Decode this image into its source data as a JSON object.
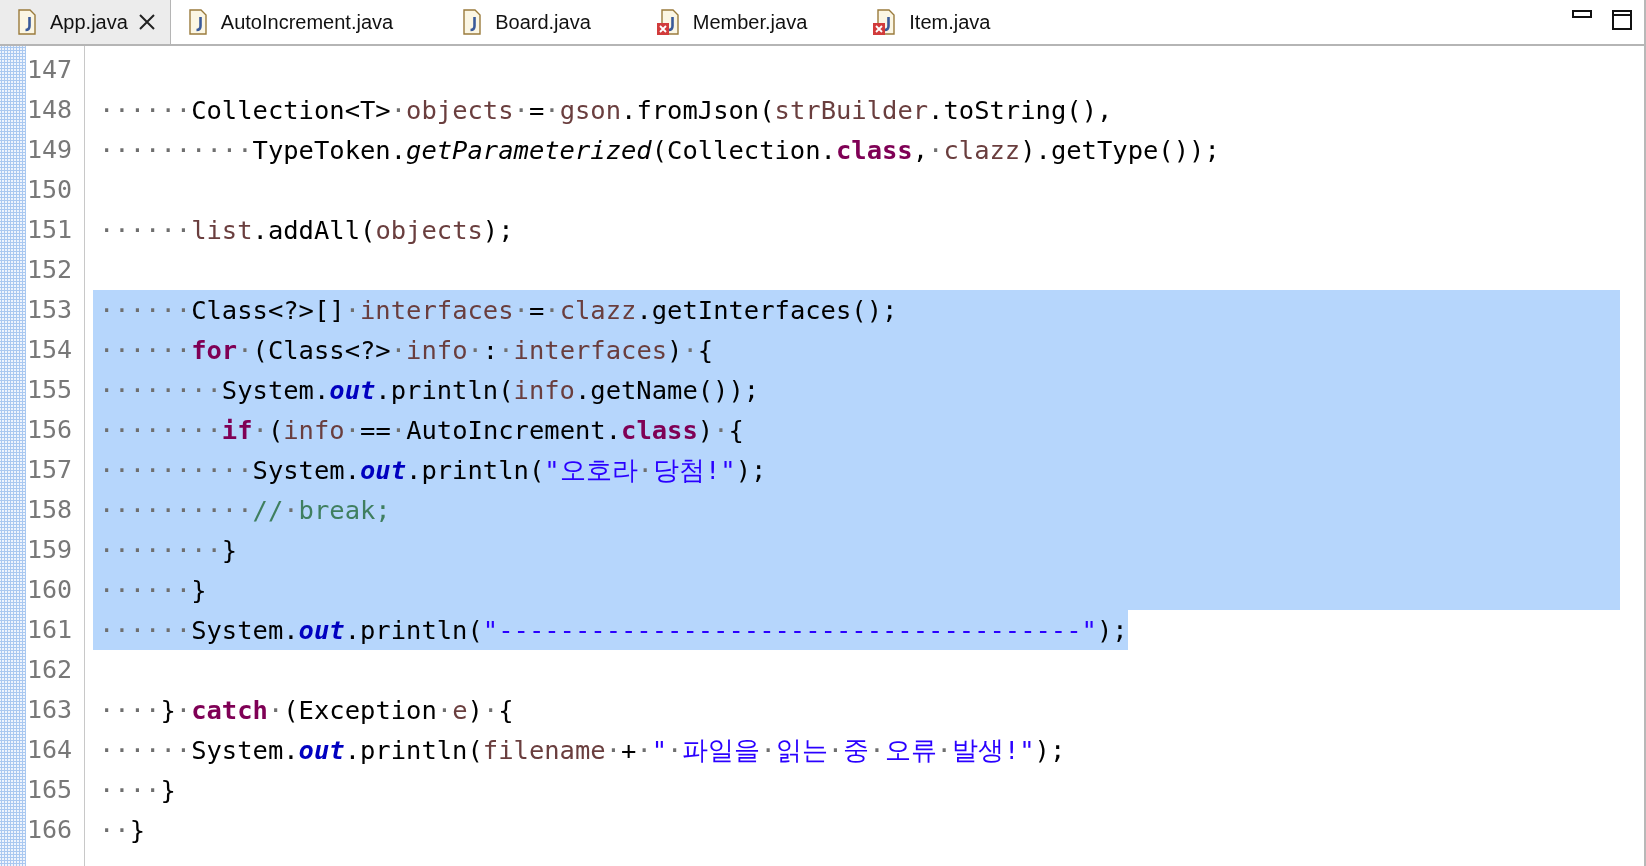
{
  "tabs": [
    {
      "label": "App.java",
      "selected": true,
      "error": false
    },
    {
      "label": "AutoIncrement.java",
      "selected": false,
      "error": false
    },
    {
      "label": "Board.java",
      "selected": false,
      "error": false
    },
    {
      "label": "Member.java",
      "selected": false,
      "error": true
    },
    {
      "label": "Item.java",
      "selected": false,
      "error": true
    }
  ],
  "lines": [
    {
      "number": "147",
      "selected": false
    },
    {
      "number": "148",
      "selected": false,
      "tokens": [
        {
          "kind": "ws",
          "t": "······"
        },
        {
          "kind": "plain",
          "t": "Collection<T>"
        },
        {
          "kind": "ws",
          "t": "·"
        },
        {
          "kind": "var",
          "t": "objects"
        },
        {
          "kind": "ws",
          "t": "·"
        },
        {
          "kind": "plain",
          "t": "="
        },
        {
          "kind": "ws",
          "t": "·"
        },
        {
          "kind": "var",
          "t": "gson"
        },
        {
          "kind": "plain",
          "t": ".fromJson("
        },
        {
          "kind": "var",
          "t": "strBuilder"
        },
        {
          "kind": "plain",
          "t": ".toString(),"
        }
      ]
    },
    {
      "number": "149",
      "selected": false,
      "tokens": [
        {
          "kind": "ws",
          "t": "··········"
        },
        {
          "kind": "plain",
          "t": "TypeToken."
        },
        {
          "kind": "italic",
          "t": "getParameterized"
        },
        {
          "kind": "plain",
          "t": "(Collection."
        },
        {
          "kind": "kw",
          "t": "class"
        },
        {
          "kind": "plain",
          "t": ","
        },
        {
          "kind": "ws",
          "t": "·"
        },
        {
          "kind": "var",
          "t": "clazz"
        },
        {
          "kind": "plain",
          "t": ").getType());"
        }
      ]
    },
    {
      "number": "150",
      "selected": false
    },
    {
      "number": "151",
      "selected": false,
      "tokens": [
        {
          "kind": "ws",
          "t": "······"
        },
        {
          "kind": "var",
          "t": "list"
        },
        {
          "kind": "plain",
          "t": ".addAll("
        },
        {
          "kind": "var",
          "t": "objects"
        },
        {
          "kind": "plain",
          "t": ");"
        }
      ]
    },
    {
      "number": "152",
      "selected": false
    },
    {
      "number": "153",
      "selected": true,
      "tokens": [
        {
          "kind": "ws",
          "t": "······"
        },
        {
          "kind": "plain",
          "t": "Class<?>[]"
        },
        {
          "kind": "ws",
          "t": "·"
        },
        {
          "kind": "var",
          "t": "interfaces"
        },
        {
          "kind": "ws",
          "t": "·"
        },
        {
          "kind": "plain",
          "t": "="
        },
        {
          "kind": "ws",
          "t": "·"
        },
        {
          "kind": "var",
          "t": "clazz"
        },
        {
          "kind": "plain",
          "t": ".getInterfaces();"
        }
      ]
    },
    {
      "number": "154",
      "selected": true,
      "tokens": [
        {
          "kind": "ws",
          "t": "······"
        },
        {
          "kind": "kw",
          "t": "for"
        },
        {
          "kind": "ws",
          "t": "·"
        },
        {
          "kind": "plain",
          "t": "(Class<?>"
        },
        {
          "kind": "ws",
          "t": "·"
        },
        {
          "kind": "var",
          "t": "info"
        },
        {
          "kind": "ws",
          "t": "·"
        },
        {
          "kind": "plain",
          "t": ":"
        },
        {
          "kind": "ws",
          "t": "·"
        },
        {
          "kind": "var",
          "t": "interfaces"
        },
        {
          "kind": "plain",
          "t": ")"
        },
        {
          "kind": "ws",
          "t": "·"
        },
        {
          "kind": "plain",
          "t": "{"
        }
      ]
    },
    {
      "number": "155",
      "selected": true,
      "tokens": [
        {
          "kind": "ws",
          "t": "········"
        },
        {
          "kind": "plain",
          "t": "System."
        },
        {
          "kind": "static",
          "t": "out"
        },
        {
          "kind": "plain",
          "t": ".println("
        },
        {
          "kind": "var",
          "t": "info"
        },
        {
          "kind": "plain",
          "t": ".getName());"
        }
      ]
    },
    {
      "number": "156",
      "selected": true,
      "tokens": [
        {
          "kind": "ws",
          "t": "········"
        },
        {
          "kind": "kw",
          "t": "if"
        },
        {
          "kind": "ws",
          "t": "·"
        },
        {
          "kind": "plain",
          "t": "("
        },
        {
          "kind": "var",
          "t": "info"
        },
        {
          "kind": "ws",
          "t": "·"
        },
        {
          "kind": "plain",
          "t": "=="
        },
        {
          "kind": "ws",
          "t": "·"
        },
        {
          "kind": "plain",
          "t": "AutoIncrement."
        },
        {
          "kind": "kw",
          "t": "class"
        },
        {
          "kind": "plain",
          "t": ")"
        },
        {
          "kind": "ws",
          "t": "·"
        },
        {
          "kind": "plain",
          "t": "{"
        }
      ]
    },
    {
      "number": "157",
      "selected": true,
      "tokens": [
        {
          "kind": "ws",
          "t": "··········"
        },
        {
          "kind": "plain",
          "t": "System."
        },
        {
          "kind": "static",
          "t": "out"
        },
        {
          "kind": "plain",
          "t": ".println("
        },
        {
          "kind": "str",
          "t": "\"오호라"
        },
        {
          "kind": "ws",
          "t": "·"
        },
        {
          "kind": "str",
          "t": "당첨!\""
        },
        {
          "kind": "plain",
          "t": ");"
        }
      ]
    },
    {
      "number": "158",
      "selected": true,
      "tokens": [
        {
          "kind": "ws",
          "t": "··········"
        },
        {
          "kind": "comment",
          "t": "//"
        },
        {
          "kind": "ws",
          "t": "·"
        },
        {
          "kind": "comment",
          "t": "break;"
        }
      ]
    },
    {
      "number": "159",
      "selected": true,
      "tokens": [
        {
          "kind": "ws",
          "t": "········"
        },
        {
          "kind": "plain",
          "t": "}"
        }
      ]
    },
    {
      "number": "160",
      "selected": true,
      "tokens": [
        {
          "kind": "ws",
          "t": "······"
        },
        {
          "kind": "plain",
          "t": "}"
        }
      ]
    },
    {
      "number": "161",
      "selected": true,
      "tokens": [
        {
          "kind": "ws",
          "t": "······"
        },
        {
          "kind": "plain",
          "t": "System."
        },
        {
          "kind": "static",
          "t": "out"
        },
        {
          "kind": "plain",
          "t": ".println("
        },
        {
          "kind": "str",
          "t": "\"--------------------------------------\""
        },
        {
          "kind": "plain",
          "t": ");"
        }
      ]
    },
    {
      "number": "162",
      "selected": false
    },
    {
      "number": "163",
      "selected": false,
      "tokens": [
        {
          "kind": "ws",
          "t": "····"
        },
        {
          "kind": "plain",
          "t": "}"
        },
        {
          "kind": "ws",
          "t": "·"
        },
        {
          "kind": "kw",
          "t": "catch"
        },
        {
          "kind": "ws",
          "t": "·"
        },
        {
          "kind": "plain",
          "t": "(Exception"
        },
        {
          "kind": "ws",
          "t": "·"
        },
        {
          "kind": "var",
          "t": "e"
        },
        {
          "kind": "plain",
          "t": ")"
        },
        {
          "kind": "ws",
          "t": "·"
        },
        {
          "kind": "plain",
          "t": "{"
        }
      ]
    },
    {
      "number": "164",
      "selected": false,
      "tokens": [
        {
          "kind": "ws",
          "t": "······"
        },
        {
          "kind": "plain",
          "t": "System."
        },
        {
          "kind": "static",
          "t": "out"
        },
        {
          "kind": "plain",
          "t": ".println("
        },
        {
          "kind": "var",
          "t": "filename"
        },
        {
          "kind": "ws",
          "t": "·"
        },
        {
          "kind": "plain",
          "t": "+"
        },
        {
          "kind": "ws",
          "t": "·"
        },
        {
          "kind": "str",
          "t": "\""
        },
        {
          "kind": "ws",
          "t": "·"
        },
        {
          "kind": "str",
          "t": "파일을"
        },
        {
          "kind": "ws",
          "t": "·"
        },
        {
          "kind": "str",
          "t": "읽는"
        },
        {
          "kind": "ws",
          "t": "·"
        },
        {
          "kind": "str",
          "t": "중"
        },
        {
          "kind": "ws",
          "t": "·"
        },
        {
          "kind": "str",
          "t": "오류"
        },
        {
          "kind": "ws",
          "t": "·"
        },
        {
          "kind": "str",
          "t": "발생!\""
        },
        {
          "kind": "plain",
          "t": ");"
        }
      ]
    },
    {
      "number": "165",
      "selected": false,
      "tokens": [
        {
          "kind": "ws",
          "t": "····"
        },
        {
          "kind": "plain",
          "t": "}"
        }
      ]
    },
    {
      "number": "166",
      "selected": false,
      "tokens": [
        {
          "kind": "ws",
          "t": "··"
        },
        {
          "kind": "plain",
          "t": "}"
        }
      ]
    }
  ]
}
